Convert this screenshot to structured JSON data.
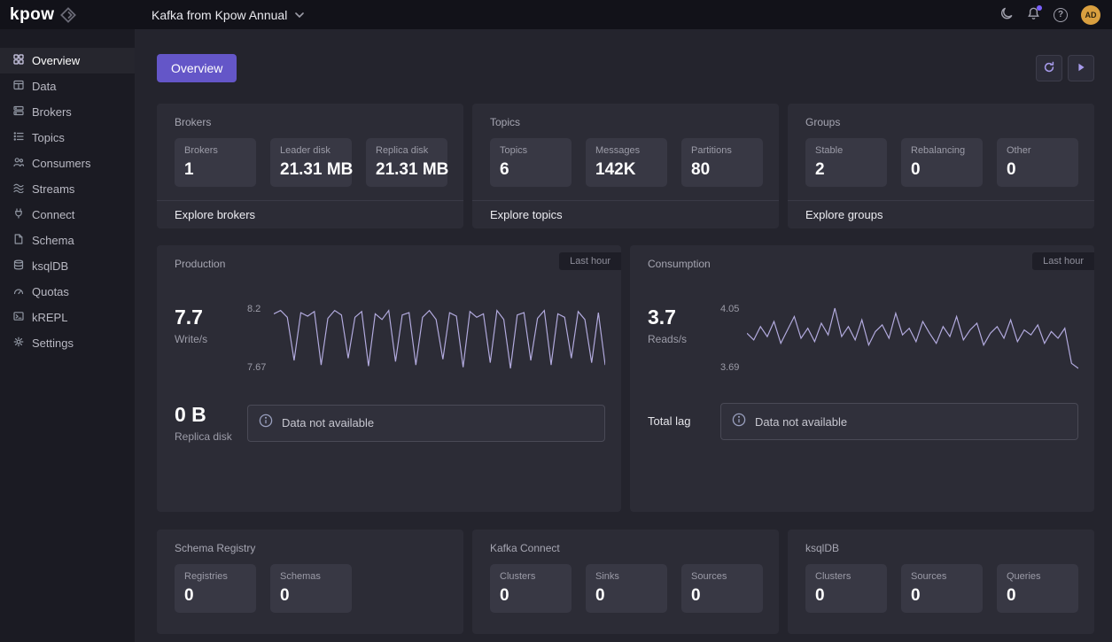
{
  "colors": {
    "accent": "#6456c8",
    "chart_line": "#b3abdf",
    "avatar_bg": "#d99f3f",
    "notification_dot": "#7b61ff"
  },
  "topbar": {
    "logo_text": "kpow",
    "cluster_selector_label": "Kafka from Kpow Annual",
    "avatar_initials": "AD"
  },
  "sidebar": {
    "items": [
      {
        "label": "Overview"
      },
      {
        "label": "Data"
      },
      {
        "label": "Brokers"
      },
      {
        "label": "Topics"
      },
      {
        "label": "Consumers"
      },
      {
        "label": "Streams"
      },
      {
        "label": "Connect"
      },
      {
        "label": "Schema"
      },
      {
        "label": "ksqlDB"
      },
      {
        "label": "Quotas"
      },
      {
        "label": "kREPL"
      },
      {
        "label": "Settings"
      }
    ]
  },
  "toolbar": {
    "overview_button": "Overview"
  },
  "cards": {
    "brokers": {
      "title": "Brokers",
      "stats": [
        {
          "label": "Brokers",
          "value": "1"
        },
        {
          "label": "Leader disk",
          "value": "21.31 MB"
        },
        {
          "label": "Replica disk",
          "value": "21.31 MB"
        }
      ],
      "footer_link": "Explore brokers"
    },
    "topics": {
      "title": "Topics",
      "stats": [
        {
          "label": "Topics",
          "value": "6"
        },
        {
          "label": "Messages",
          "value": "142K"
        },
        {
          "label": "Partitions",
          "value": "80"
        }
      ],
      "footer_link": "Explore topics"
    },
    "groups": {
      "title": "Groups",
      "stats": [
        {
          "label": "Stable",
          "value": "2"
        },
        {
          "label": "Rebalancing",
          "value": "0"
        },
        {
          "label": "Other",
          "value": "0"
        }
      ],
      "footer_link": "Explore groups"
    },
    "production": {
      "title": "Production",
      "badge": "Last hour",
      "primary_value": "7.7",
      "primary_label": "Write/s",
      "chart_max": "8.2",
      "chart_min": "7.67",
      "secondary_value": "0 B",
      "secondary_label": "Replica disk",
      "alert_text": "Data not available"
    },
    "consumption": {
      "title": "Consumption",
      "badge": "Last hour",
      "primary_value": "3.7",
      "primary_label": "Reads/s",
      "chart_max": "4.05",
      "chart_min": "3.69",
      "secondary_label": "Total lag",
      "alert_text": "Data not available"
    },
    "schema_registry": {
      "title": "Schema Registry",
      "stats": [
        {
          "label": "Registries",
          "value": "0"
        },
        {
          "label": "Schemas",
          "value": "0"
        }
      ]
    },
    "kafka_connect": {
      "title": "Kafka Connect",
      "stats": [
        {
          "label": "Clusters",
          "value": "0"
        },
        {
          "label": "Sinks",
          "value": "0"
        },
        {
          "label": "Sources",
          "value": "0"
        }
      ]
    },
    "ksqldb": {
      "title": "ksqlDB",
      "stats": [
        {
          "label": "Clusters",
          "value": "0"
        },
        {
          "label": "Sources",
          "value": "0"
        },
        {
          "label": "Queries",
          "value": "0"
        }
      ]
    }
  },
  "chart_data": [
    {
      "type": "line",
      "title": "Production",
      "series_name": "Write/s",
      "current_value": 7.7,
      "window": "Last hour",
      "ylim": [
        7.67,
        8.2
      ],
      "ymax_label": "8.2",
      "ymin_label": "7.67",
      "grid": false,
      "legend": "none",
      "values": [
        8.15,
        8.18,
        8.12,
        7.74,
        8.16,
        8.13,
        8.17,
        7.7,
        8.11,
        8.18,
        8.14,
        7.76,
        8.12,
        8.17,
        7.69,
        8.15,
        8.1,
        8.18,
        7.73,
        8.14,
        8.16,
        7.7,
        8.12,
        8.18,
        8.1,
        7.75,
        8.16,
        8.13,
        7.68,
        8.17,
        8.12,
        8.15,
        7.72,
        8.18,
        8.1,
        7.67,
        8.14,
        8.16,
        7.74,
        8.11,
        8.18,
        7.7,
        8.15,
        8.12,
        7.76,
        8.17,
        8.1,
        7.72,
        8.16,
        7.7
      ]
    },
    {
      "type": "line",
      "title": "Consumption",
      "series_name": "Reads/s",
      "current_value": 3.7,
      "window": "Last hour",
      "ylim": [
        3.69,
        4.05
      ],
      "ymax_label": "4.05",
      "ymin_label": "3.69",
      "grid": false,
      "legend": "none",
      "values": [
        3.9,
        3.86,
        3.94,
        3.88,
        3.97,
        3.84,
        3.92,
        4.0,
        3.87,
        3.93,
        3.85,
        3.96,
        3.89,
        4.05,
        3.88,
        3.94,
        3.86,
        3.98,
        3.83,
        3.91,
        3.95,
        3.87,
        4.02,
        3.89,
        3.93,
        3.85,
        3.97,
        3.9,
        3.84,
        3.94,
        3.88,
        4.0,
        3.86,
        3.92,
        3.96,
        3.83,
        3.9,
        3.94,
        3.87,
        3.98,
        3.85,
        3.92,
        3.89,
        3.95,
        3.84,
        3.91,
        3.87,
        3.93,
        3.72,
        3.69
      ]
    }
  ]
}
